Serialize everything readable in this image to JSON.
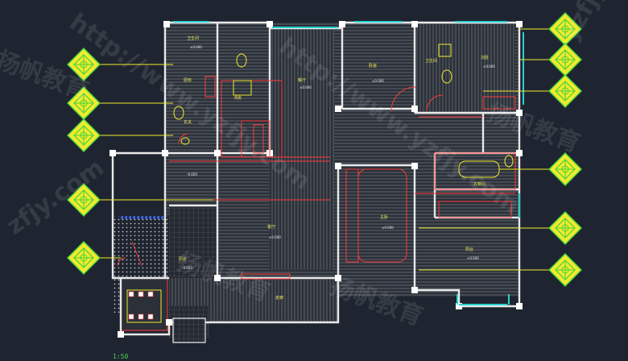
{
  "drawing": {
    "background": "#1f2530",
    "scale_caption": "1:50",
    "colors": {
      "wall": "#e9e9e9",
      "red": "#ff3a3a",
      "floor": "#6a6f78",
      "cyan": "#28d2d2",
      "yellow": "#f2ea2e",
      "green": "#3fd43f",
      "blue": "#3a64ff"
    }
  },
  "watermarks": {
    "url_a": "http://www.yzfjy.com",
    "url_b": "http://www.yzfjy.com",
    "url_c": "yzfjy",
    "url_d": "zfjy.com",
    "brand_a": "扬帆教育",
    "brand_b": "扬帆教育",
    "brand_c": "扬帆教育",
    "brand_d": "扬帆教育"
  },
  "rooms": {
    "living": "客厅",
    "dining": "餐厅",
    "study": "书房",
    "master": "主卧",
    "bed2": "次卧",
    "bed3": "卧室",
    "bath1": "卫生间",
    "bath2": "卫生间",
    "kitchen": "厨房",
    "balcony1": "阳台",
    "balcony2": "阳台",
    "entry": "玄关",
    "walkway": "走廊",
    "cloak": "衣帽间"
  },
  "elevations": {
    "e1": "±0.000",
    "e2": "±0.000",
    "e3": "±0.000",
    "e4": "±0.000",
    "e5": "±0.000",
    "e6": "±0.000",
    "e7": "±0.000",
    "e8": "-0.020",
    "e9": "-0.020"
  }
}
